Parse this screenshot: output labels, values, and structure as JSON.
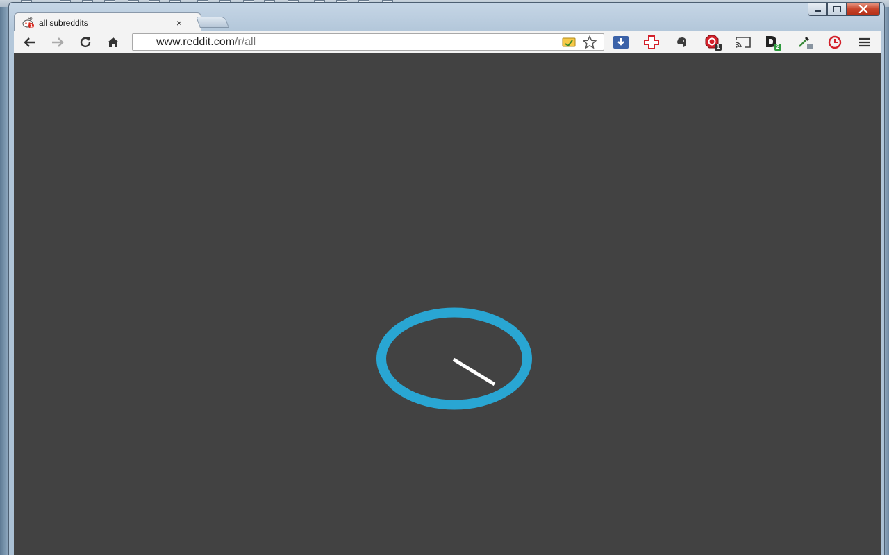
{
  "tab": {
    "title": "all subreddits",
    "close_glyph": "×",
    "favicon": "reddit-alien-icon",
    "favicon_badge": "1"
  },
  "toolbar": {
    "back_icon": "arrow-left-icon",
    "forward_icon": "arrow-right-icon",
    "reload_icon": "reload-icon",
    "home_icon": "home-icon"
  },
  "omnibox": {
    "url_host": "www.reddit.com",
    "url_path": "/r/all"
  },
  "extensions": [
    {
      "name": "pocket-download-icon"
    },
    {
      "name": "medical-cross-icon"
    },
    {
      "name": "evernote-elephant-icon"
    },
    {
      "name": "adblock-stop-icon",
      "badge": "1"
    },
    {
      "name": "cast-icon"
    },
    {
      "name": "d-extension-icon",
      "badge": "2"
    },
    {
      "name": "eyedropper-icon"
    },
    {
      "name": "clock-icon"
    },
    {
      "name": "chrome-menu-icon"
    }
  ],
  "colors": {
    "page_bg": "#424242",
    "spinner": "#29a6d3",
    "spinner_hand": "#ffffff"
  }
}
